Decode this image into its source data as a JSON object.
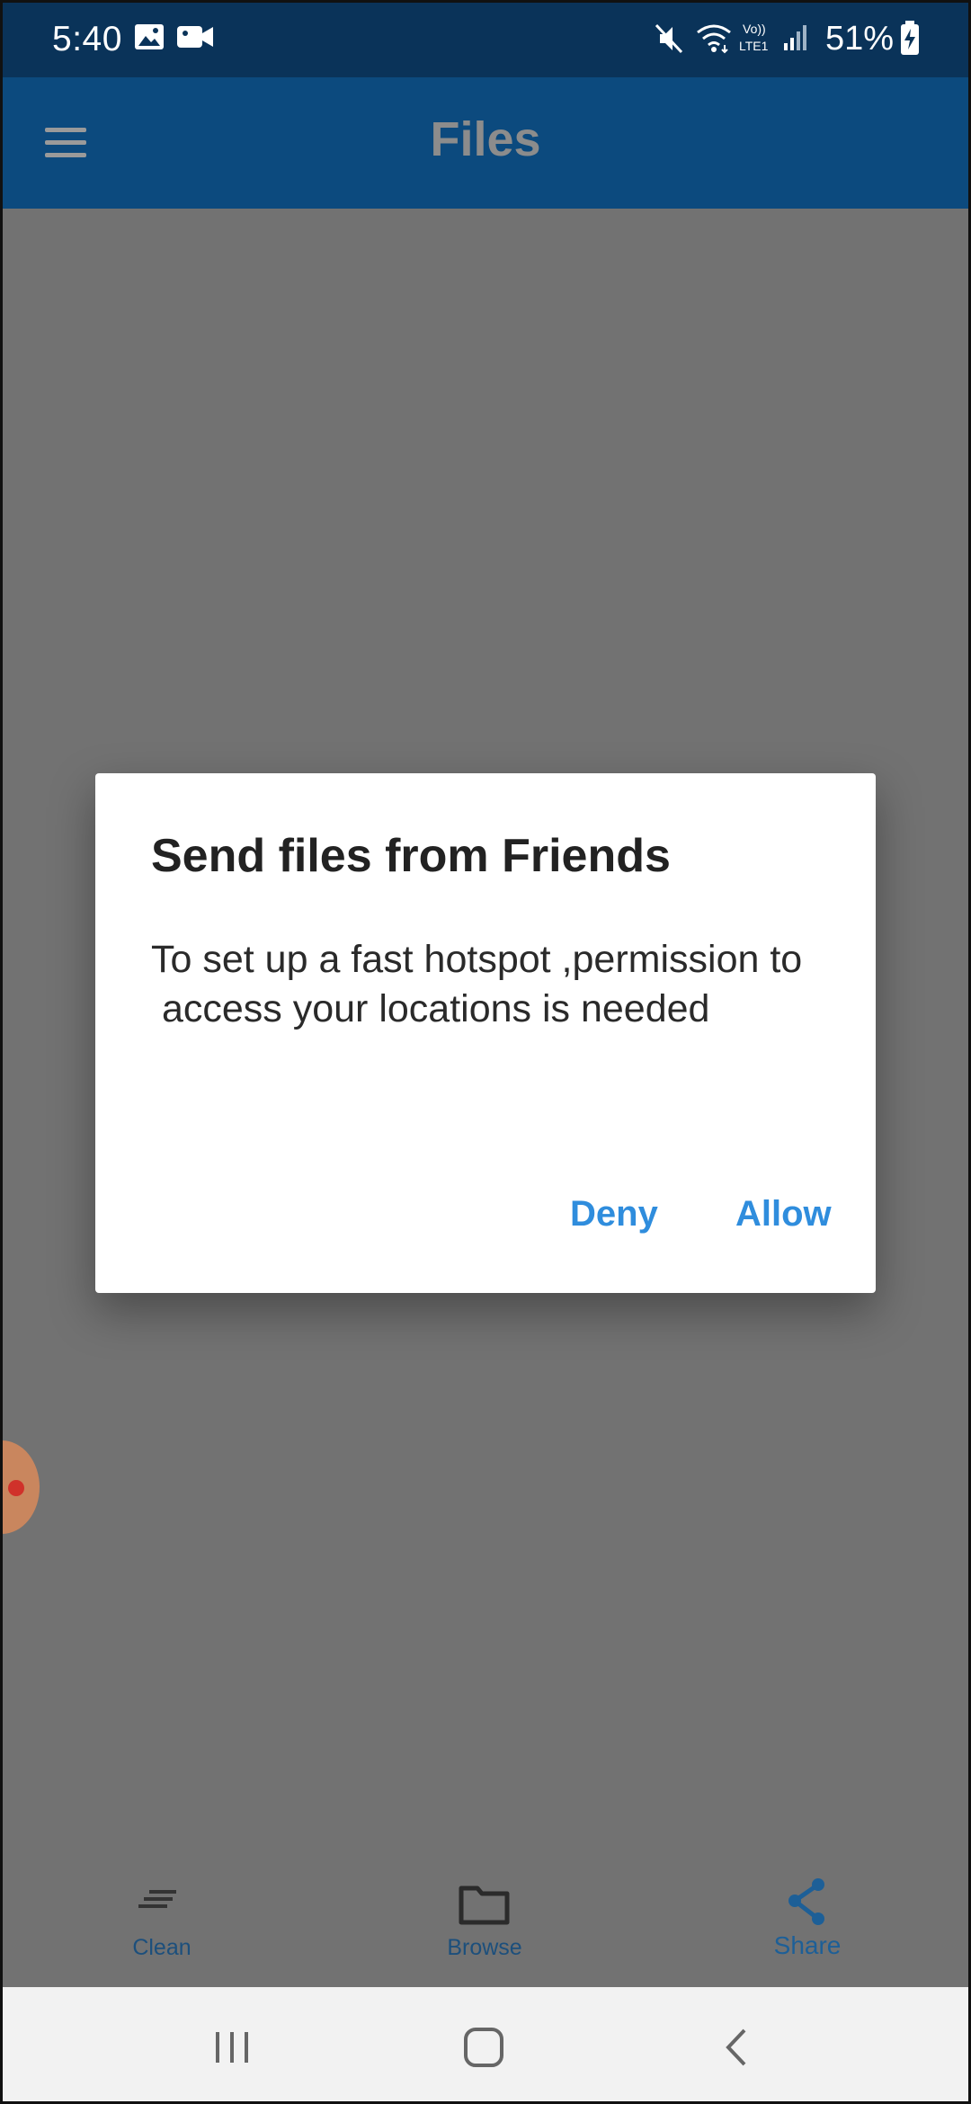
{
  "status_bar": {
    "time": "5:40",
    "battery_percent": "51%",
    "icons": [
      "gallery-icon",
      "video-camera-icon",
      "mute-icon",
      "wifi-icon",
      "volte-lte-icon",
      "signal-icon",
      "battery-charging-icon"
    ]
  },
  "app_bar": {
    "title": "Files",
    "menu_icon": "hamburger-menu-icon"
  },
  "dialog": {
    "title": "Send files from Friends",
    "message": "To set up a fast hotspot ,permission to\n access your locations is needed",
    "deny_label": "Deny",
    "allow_label": "Allow"
  },
  "tabs": [
    {
      "label": "Clean",
      "icon": "clean-lines-icon"
    },
    {
      "label": "Browse",
      "icon": "folder-icon"
    },
    {
      "label": "Share",
      "icon": "share-icon"
    }
  ],
  "nav_bar": {
    "icons": [
      "recent-apps-icon",
      "home-icon",
      "back-icon"
    ]
  },
  "colors": {
    "status_bar": "#0a3359",
    "app_bar": "#0c4a7e",
    "scrim": "#727272",
    "accent": "#2f8ddd"
  }
}
